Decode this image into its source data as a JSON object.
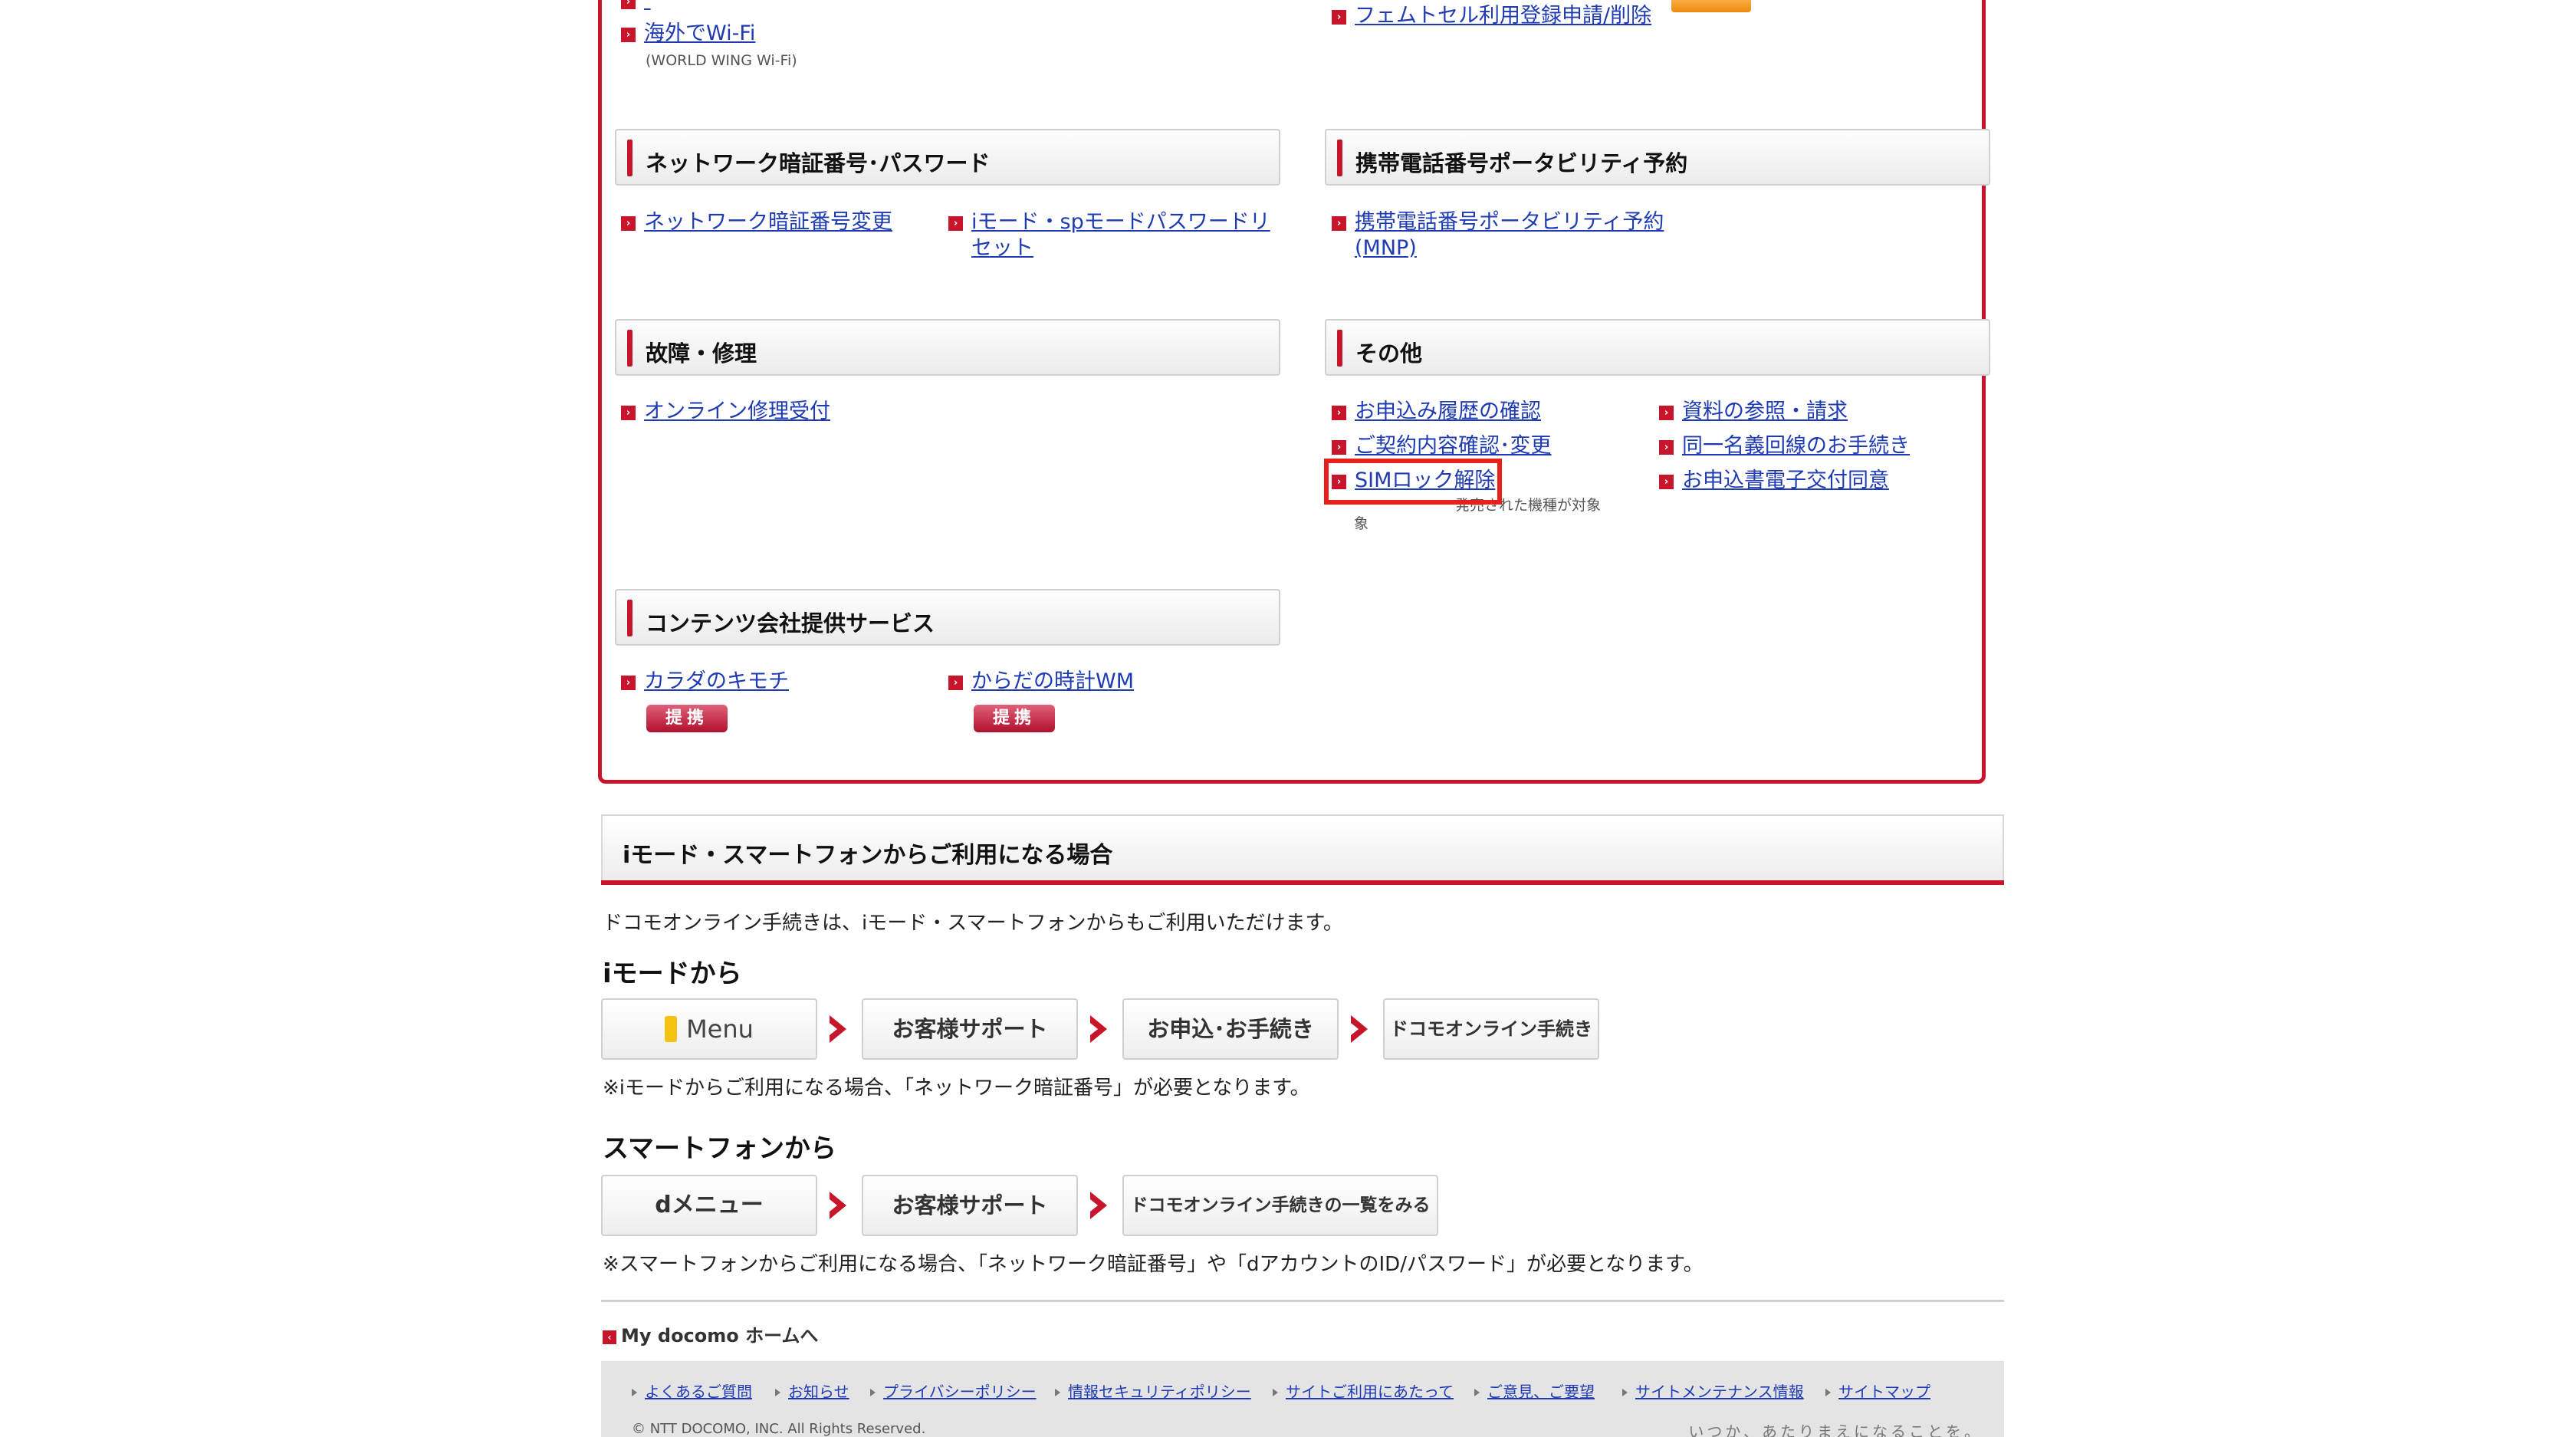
{
  "panel": {
    "top_links": {
      "overseas_wifi": "海外でWi-Fi",
      "overseas_wifi_note": "(WORLD WING Wi-Fi)",
      "femtocell": "フェムトセル利用登録申請/削除"
    },
    "network": {
      "title": "ネットワーク暗証番号･パスワード",
      "links": [
        "ネットワーク暗証番号変更",
        "iモード・spモードパスワードリセット"
      ]
    },
    "mnp": {
      "title": "携帯電話番号ポータビリティ予約",
      "links": [
        "携帯電話番号ポータビリティ予約(MNP)"
      ]
    },
    "repair": {
      "title": "故障・修理",
      "links": [
        "オンライン修理受付"
      ]
    },
    "other": {
      "title": "その他",
      "links": [
        "お申込み履歴の確認",
        "ご契約内容確認･変更",
        "SIMロック解除",
        "資料の参照・請求",
        "同一名義回線のお手続き",
        "お申込書電子交付同意"
      ],
      "sim_note": "発売された機種が対象"
    },
    "contents": {
      "title": "コンテンツ会社提供サービス",
      "links": [
        "カラダのキモチ",
        "からだの時計WM"
      ],
      "tag": "提携"
    }
  },
  "mobile": {
    "title": "iモード・スマートフォンからご利用になる場合",
    "intro": "ドコモオンライン手続きは、iモード・スマートフォンからもご利用いただけます。",
    "imode": {
      "heading": "iモードから",
      "steps": [
        "Menu",
        "お客様サポート",
        "お申込･お手続き",
        "ドコモオンライン手続き"
      ],
      "note": "※iモードからご利用になる場合、「ネットワーク暗証番号」が必要となります。"
    },
    "smartphone": {
      "heading": "スマートフォンから",
      "steps": [
        "dメニュー",
        "お客様サポート",
        "ドコモオンライン手続きの一覧をみる"
      ],
      "note": "※スマートフォンからご利用になる場合、「ネットワーク暗証番号」や「dアカウントのID/パスワード」が必要となります。"
    }
  },
  "footer": {
    "home_link": "My docomo ホームへ",
    "links": [
      "よくあるご質問",
      "お知らせ",
      "プライバシーポリシー",
      "情報セキュリティポリシー",
      "サイトご利用にあたって",
      "ご意見、ご要望",
      "サイトメンテナンス情報",
      "サイトマップ"
    ],
    "copyright": "© NTT DOCOMO, INC. All Rights Reserved.",
    "slogan": "いつか、あたりまえになることを。"
  },
  "colors": {
    "accent_red": "#c7162b",
    "link_blue": "#1f3bb3",
    "highlight": "#e8201c"
  }
}
